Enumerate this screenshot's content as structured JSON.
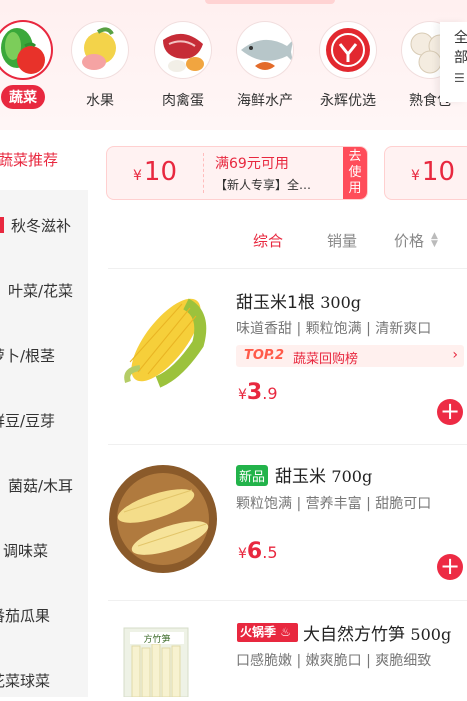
{
  "categories": [
    {
      "label": "蔬菜",
      "icon": "vegetable-icon",
      "active": true
    },
    {
      "label": "水果",
      "icon": "fruit-icon",
      "active": false
    },
    {
      "label": "肉禽蛋",
      "icon": "meat-egg-icon",
      "active": false
    },
    {
      "label": "海鲜水产",
      "icon": "seafood-icon",
      "active": false
    },
    {
      "label": "永辉优选",
      "icon": "yonghui-logo-icon",
      "active": false
    },
    {
      "label": "熟食包",
      "icon": "dumpling-icon",
      "active": false
    }
  ],
  "all_button": {
    "line1": "全",
    "line2": "部",
    "icon": "list-icon"
  },
  "sidebar": {
    "items": [
      {
        "label": "蔬菜推荐",
        "active": true
      },
      {
        "label": "秋冬滋补",
        "active": false
      },
      {
        "label": "叶菜/花菜",
        "active": false
      },
      {
        "label": "萝卜/根茎",
        "active": false
      },
      {
        "label": "鲜豆/豆芽",
        "active": false
      },
      {
        "label": "菌菇/木耳",
        "active": false
      },
      {
        "label": "调味菜",
        "active": false
      },
      {
        "label": "番茄瓜果",
        "active": false
      },
      {
        "label": "花菜球菜",
        "active": false
      }
    ]
  },
  "coupons": [
    {
      "currency": "¥",
      "amount": "10",
      "condition": "满69元可用",
      "desc": "【新人专享】全…",
      "button": "去使用"
    },
    {
      "currency": "¥",
      "amount": "10"
    }
  ],
  "sort": {
    "comprehensive": "综合",
    "sales": "销量",
    "price": "价格"
  },
  "products": [
    {
      "name": "甜玉米1根",
      "weight": "300g",
      "desc": "味道香甜 | 颗粒饱满 | 清新爽口",
      "rank_badge": "TOP.2",
      "rank_text": "蔬菜回购榜",
      "currency": "¥",
      "price_int": "3",
      "price_dec": ".9",
      "image": "corn-icon"
    },
    {
      "tag": "新品",
      "name": "甜玉米",
      "weight": "700g",
      "desc": "颗粒饱满 | 营养丰富 | 甜脆可口",
      "currency": "¥",
      "price_int": "6",
      "price_dec": ".5",
      "image": "corn-basket-icon"
    },
    {
      "tag": "火锅季",
      "name": "大自然方竹笋",
      "weight": "500g",
      "desc": "口感脆嫩 | 嫩爽脆口 | 爽脆细致",
      "image": "bamboo-shoot-pack-icon",
      "package_text": "方竹笋"
    }
  ],
  "colors": {
    "accent": "#e8283f",
    "new_tag": "#22b34a"
  }
}
